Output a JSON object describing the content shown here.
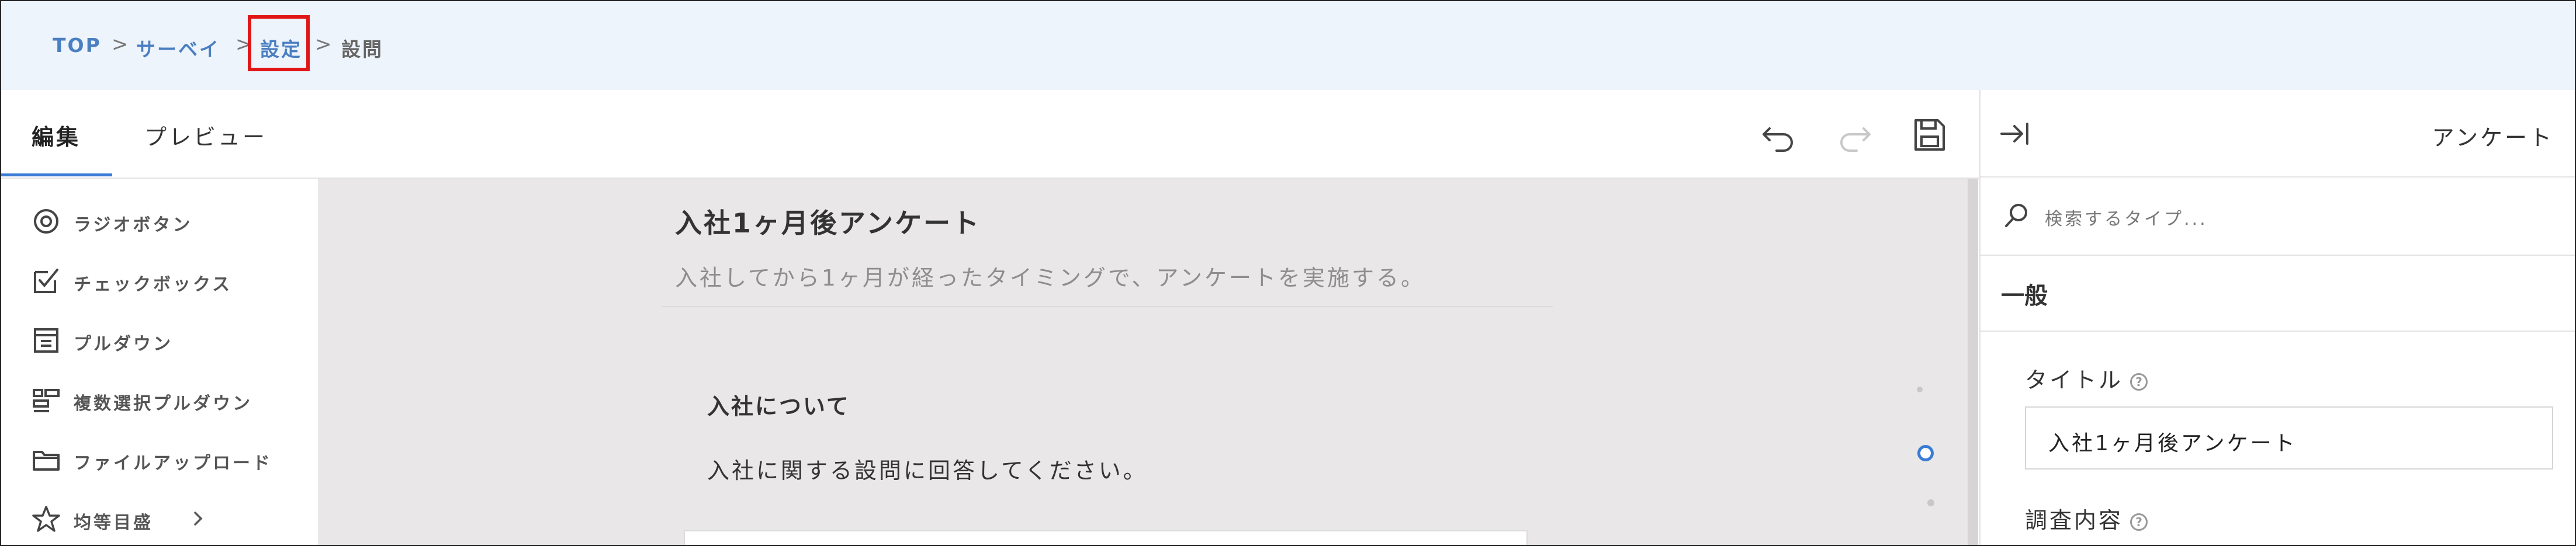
{
  "breadcrumb": {
    "top": "TOP",
    "survey": "サーベイ",
    "settings": "設定",
    "questions": "設問",
    "separator": ">"
  },
  "tabs": {
    "edit": "編集",
    "preview": "プレビュー"
  },
  "palette": {
    "items": [
      {
        "label": "ラジオボタン",
        "icon": "radio-icon"
      },
      {
        "label": "チェックボックス",
        "icon": "checkbox-icon"
      },
      {
        "label": "プルダウン",
        "icon": "dropdown-icon"
      },
      {
        "label": "複数選択プルダウン",
        "icon": "multi-dropdown-icon"
      },
      {
        "label": "ファイルアップロード",
        "icon": "folder-icon"
      },
      {
        "label": "均等目盛",
        "icon": "star-icon"
      }
    ]
  },
  "survey": {
    "title": "入社1ヶ月後アンケート",
    "description": "入社してから1ヶ月が経ったタイミングで、アンケートを実施する。",
    "section": {
      "title": "入社について",
      "description": "入社に関する設問に回答してください。"
    }
  },
  "panel": {
    "title": "アンケート",
    "search_placeholder": "検索するタイプ...",
    "general": "一般",
    "title_label": "タイトル",
    "title_value": "入社1ヶ月後アンケート",
    "content_label": "調査内容",
    "help": "?"
  },
  "colors": {
    "accent": "#3a7bd5",
    "breadcrumb_bg": "#eef4fc",
    "highlight": "#e01616",
    "canvas": "#e9e7e7"
  }
}
